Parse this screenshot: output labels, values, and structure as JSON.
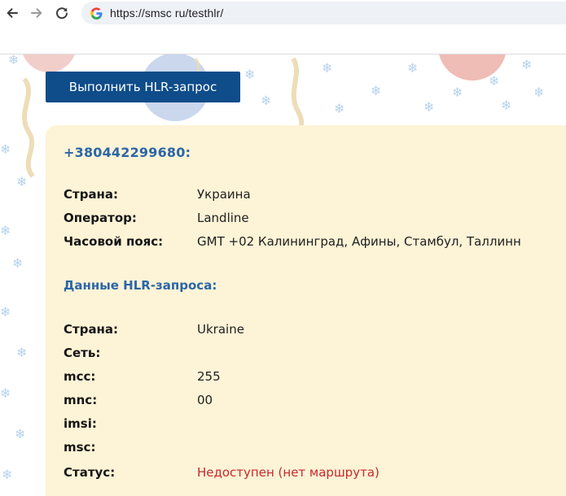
{
  "browser": {
    "url": "https://smsc ru/testhlr/"
  },
  "page": {
    "button_label": "Выполнить HLR-запрос",
    "phone": "+380442299680:",
    "info_rows": [
      {
        "label": "Страна:",
        "value": "Украина"
      },
      {
        "label": "Оператор:",
        "value": "Landline"
      },
      {
        "label": "Часовой пояс:",
        "value": "GMT +02 Калининград, Афины, Стамбул, Таллинн"
      }
    ],
    "hlr_title": "Данные HLR-запроса:",
    "hlr_rows": [
      {
        "label": "Страна:",
        "value": "Ukraine"
      },
      {
        "label": "Сеть:",
        "value": ""
      },
      {
        "label": "mcc:",
        "value": "255"
      },
      {
        "label": "mnc:",
        "value": "00"
      },
      {
        "label": "imsi:",
        "value": ""
      },
      {
        "label": "msc:",
        "value": ""
      },
      {
        "label": "Статус:",
        "value": "Недоступен (нет маршрута)"
      }
    ]
  },
  "colors": {
    "button": "#0e4c8a",
    "accent_blue": "#2b66a8",
    "card_bg": "#fdf3d6",
    "status_red": "#c8282b"
  }
}
